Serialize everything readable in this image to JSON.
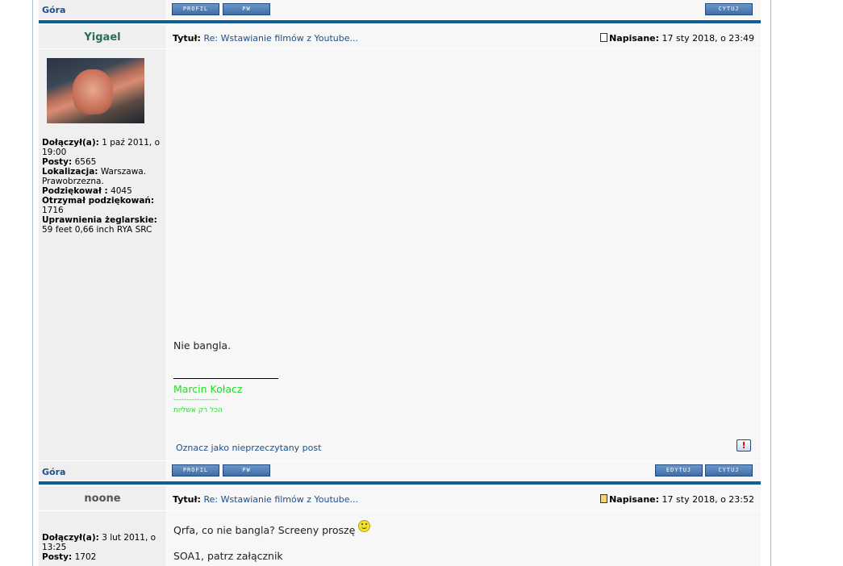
{
  "top_bar": {
    "gora_label": "Góra",
    "btn_profil": "PROFIL",
    "btn_pw": "PW",
    "btn_cytuj": "CYTUJ"
  },
  "post1": {
    "username": "Yigael",
    "title_label": "Tytuł:",
    "title_value": "Re: Wstawianie filmów z Youtube...",
    "posted_label": "Napisane:",
    "posted_value": "17 sty 2018, o 23:49",
    "profile": [
      {
        "label": "Dołączył(a):",
        "value": "1 paź 2011, o 19:00"
      },
      {
        "label": "Posty:",
        "value": "6565"
      },
      {
        "label": "Lokalizacja:",
        "value": "Warszawa. Prawobrzezna."
      },
      {
        "label": "Podziękował :",
        "value": "4045"
      },
      {
        "label": "Otrzymał podziękowań:",
        "value": "1716"
      },
      {
        "label": "Uprawnienia żeglarskie:",
        "value": "59 feet 0,66 inch RYA SRC"
      }
    ],
    "body": "Nie bangla.",
    "signature_name": "Marcin Kołacz",
    "signature_dashes": "-----------------",
    "signature_hebrew": "הכל רק אשליות",
    "mark_unread": "Oznacz jako nieprzeczytany post",
    "report_icon": "!",
    "gora_label": "Góra",
    "btn_profil": "PROFIL",
    "btn_pw": "PW",
    "btn_edytuj": "EDYTUJ",
    "btn_cytuj": "CYTUJ"
  },
  "post2": {
    "username": "noone",
    "title_label": "Tytuł:",
    "title_value": "Re: Wstawianie filmów z Youtube...",
    "posted_label": "Napisane:",
    "posted_value": "17 sty 2018, o 23:52",
    "profile": [
      {
        "label": "Dołączył(a):",
        "value": "3 lut 2011, o 13:25"
      },
      {
        "label": "Posty:",
        "value": "1702"
      }
    ],
    "body_line1": "Qrfa, co nie bangla? Screeny proszę",
    "body_line2": "SOA1, patrz załącznik"
  },
  "colors": {
    "accent": "#0f5e96",
    "link": "#1f4e8c",
    "username1": "#2a6e52",
    "username2": "#555555",
    "signature": "#22dd22"
  }
}
